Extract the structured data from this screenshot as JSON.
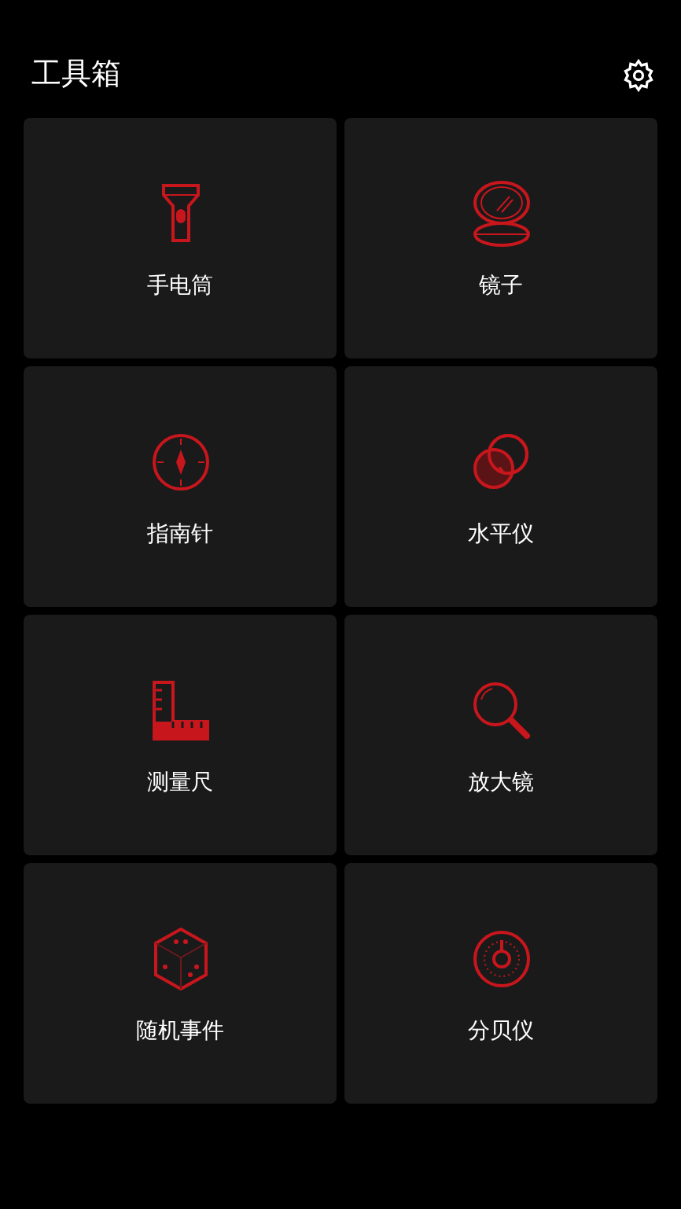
{
  "header": {
    "title": "工具箱"
  },
  "tools": [
    {
      "kind": "flashlight",
      "label": "手电筒"
    },
    {
      "kind": "mirror",
      "label": "镜子"
    },
    {
      "kind": "compass",
      "label": "指南针"
    },
    {
      "kind": "level",
      "label": "水平仪"
    },
    {
      "kind": "ruler",
      "label": "测量尺"
    },
    {
      "kind": "magnifier",
      "label": "放大镜"
    },
    {
      "kind": "dice",
      "label": "随机事件"
    },
    {
      "kind": "decibel",
      "label": "分贝仪"
    }
  ]
}
